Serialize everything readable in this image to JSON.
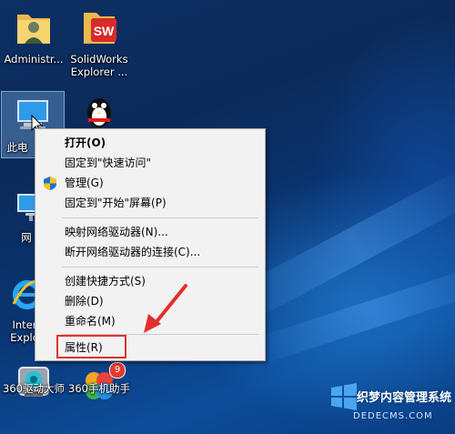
{
  "desktop": {
    "icons": [
      {
        "name": "administrator-folder-icon",
        "label": "Administr..."
      },
      {
        "name": "solidworks-explorer-icon",
        "label": "SolidWorks\nExplorer ..."
      },
      {
        "name": "this-pc-icon",
        "label": "此电"
      },
      {
        "name": "qq-icon",
        "label": ""
      },
      {
        "name": "network-icon",
        "label": "网"
      },
      {
        "name": "internet-explorer-icon",
        "label": "Inter\nExplo"
      },
      {
        "name": "360-driver-master-icon",
        "label": "360驱动大师"
      },
      {
        "name": "360-mobile-assistant-icon",
        "label": "360手机助手"
      }
    ],
    "badge_360_mobile": "9",
    "solidworks_logo": "SW"
  },
  "context_menu": {
    "items": [
      {
        "label": "打开(O)",
        "bold": true
      },
      {
        "label": "固定到\"快速访问\""
      },
      {
        "label": "管理(G)"
      },
      {
        "label": "固定到\"开始\"屏幕(P)"
      },
      {
        "label": "映射网络驱动器(N)..."
      },
      {
        "label": "断开网络驱动器的连接(C)..."
      },
      {
        "label": "创建快捷方式(S)"
      },
      {
        "label": "删除(D)"
      },
      {
        "label": "重命名(M)"
      },
      {
        "label": "属性(R)"
      }
    ],
    "highlight_color": "#e0312f"
  },
  "watermark": {
    "brand": "织梦内容管理系统",
    "url": "DEDECMS.COM"
  }
}
